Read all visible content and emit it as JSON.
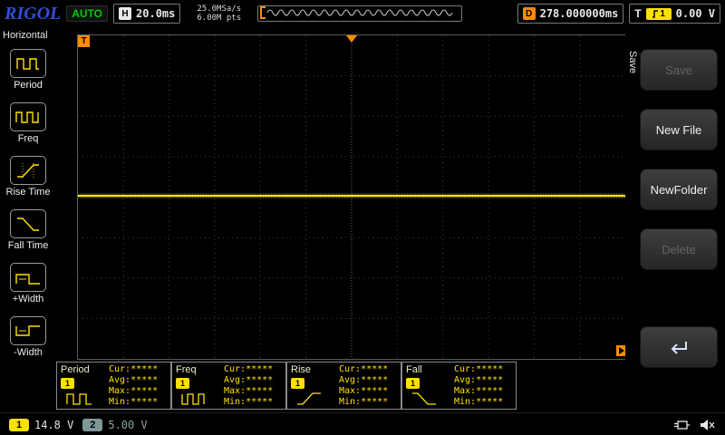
{
  "top_bar": {
    "logo": "RIGOL",
    "run_status": "AUTO",
    "horizontal": {
      "label": "H",
      "timebase": "20.0ms"
    },
    "acquisition": {
      "sample_rate": "25.0MSa/s",
      "memory_depth": "6.00M pts"
    },
    "delay": {
      "label": "D",
      "value": "278.000000ms"
    },
    "trigger": {
      "label": "T",
      "channel": "1",
      "level": "0.00 V"
    }
  },
  "left_sidebar": {
    "title": "Horizontal",
    "items": [
      {
        "label": "Period",
        "icon": "period-icon"
      },
      {
        "label": "Freq",
        "icon": "freq-icon"
      },
      {
        "label": "Rise Time",
        "icon": "rise-time-icon"
      },
      {
        "label": "Fall Time",
        "icon": "fall-time-icon"
      },
      {
        "label": "+Width",
        "icon": "plus-width-icon"
      },
      {
        "label": "-Width",
        "icon": "minus-width-icon"
      }
    ]
  },
  "right_panel": {
    "tab": "Save",
    "buttons": [
      {
        "label": "Save",
        "enabled": false
      },
      {
        "label": "New File",
        "enabled": true
      },
      {
        "label": "NewFolder",
        "enabled": true
      },
      {
        "label": "Delete",
        "enabled": false
      }
    ],
    "enter_button": {
      "icon": "return-arrow-icon",
      "enabled": true
    }
  },
  "measurements": [
    {
      "name": "Period",
      "channel": "1",
      "icon": "period-waveform-icon",
      "rows": [
        "Cur:*****",
        "Avg:*****",
        "Max:*****",
        "Min:*****"
      ]
    },
    {
      "name": "Freq",
      "channel": "1",
      "icon": "freq-waveform-icon",
      "rows": [
        "Cur:*****",
        "Avg:*****",
        "Max:*****",
        "Min:*****"
      ]
    },
    {
      "name": "Rise",
      "channel": "1",
      "icon": "rise-waveform-icon",
      "rows": [
        "Cur:*****",
        "Avg:*****",
        "Max:*****",
        "Min:*****"
      ]
    },
    {
      "name": "Fall",
      "channel": "1",
      "icon": "fall-waveform-icon",
      "rows": [
        "Cur:*****",
        "Avg:*****",
        "Max:*****",
        "Min:*****"
      ]
    }
  ],
  "status_bar": {
    "channel1": {
      "label": "1",
      "value": "14.8 V"
    },
    "channel2": {
      "label": "2",
      "value": "5.00 V"
    },
    "icons": [
      "usb-icon",
      "speaker-icon"
    ]
  },
  "colors": {
    "trace_yellow": "#ffe400",
    "marker_orange": "#ff8b00",
    "auto_green": "#00c800",
    "logo_blue": "#2f4fd8",
    "channel2_dim": "#7e9898"
  }
}
